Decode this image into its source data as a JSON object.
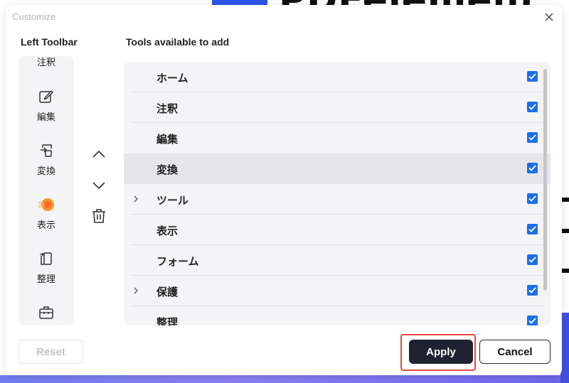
{
  "background": {
    "banner_text": "PDFelement"
  },
  "dialog": {
    "title": "Customize",
    "left_toolbar_label": "Left Toolbar",
    "tools_label": "Tools available to add"
  },
  "left_toolbar": {
    "items": [
      {
        "label": "注釈",
        "icon": "annotate-icon"
      },
      {
        "label": "編集",
        "icon": "edit-icon"
      },
      {
        "label": "変換",
        "icon": "convert-icon"
      },
      {
        "label": "表示",
        "icon": "view-icon"
      },
      {
        "label": "整理",
        "icon": "organize-icon"
      },
      {
        "label": "",
        "icon": "toolbox-icon"
      }
    ]
  },
  "tools": [
    {
      "name": "ホーム",
      "checked": true,
      "expandable": false
    },
    {
      "name": "注釈",
      "checked": true,
      "expandable": false
    },
    {
      "name": "編集",
      "checked": true,
      "expandable": false
    },
    {
      "name": "変換",
      "checked": true,
      "expandable": false,
      "highlighted": true
    },
    {
      "name": "ツール",
      "checked": true,
      "expandable": true
    },
    {
      "name": "表示",
      "checked": true,
      "expandable": false
    },
    {
      "name": "フォーム",
      "checked": true,
      "expandable": false
    },
    {
      "name": "保護",
      "checked": true,
      "expandable": true
    },
    {
      "name": "整理",
      "checked": true,
      "expandable": false
    }
  ],
  "footer": {
    "reset_label": "Reset",
    "apply_label": "Apply",
    "cancel_label": "Cancel"
  },
  "colors": {
    "checkbox": "#1b6fe8",
    "apply_bg": "#1f2230",
    "highlight_box": "#e34a3f"
  }
}
